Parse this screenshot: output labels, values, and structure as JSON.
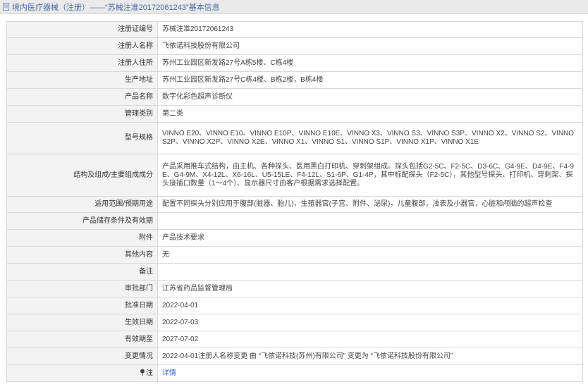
{
  "header": {
    "title": "境内医疗器械（注册）——“苏械注准20172061243”基本信息"
  },
  "rows": [
    {
      "label": "注册证编号",
      "value": "苏械注准20172061243"
    },
    {
      "label": "注册人名称",
      "value": "飞依诺科技股份有限公司"
    },
    {
      "label": "注册人住所",
      "value": "苏州工业园区新发路27号A栋5楼、C栋4楼"
    },
    {
      "label": "生产地址",
      "value": "苏州工业园区新发路27号C栋4楼、B栋2楼，B栋4楼"
    },
    {
      "label": "产品名称",
      "value": "数字化彩色超声诊断仪"
    },
    {
      "label": "管理类别",
      "value": "第二类"
    },
    {
      "label": "型号规格",
      "value": "VINNO E20、VINNO E10、VINNO E10P、VINNO E10E、VINNO X3、VINNO S3、VINNO S3P、VINNO X2、VINNO S2、VINNO S2P、VINNO X2P、VINNO X2E、VINNO X1、VINNO S1、VINNO S1P、VINNO X1P、VINNO X1E"
    },
    {
      "label": "结构及组成/主要组成成分",
      "value": "产品采用推车式结构，由主机、各种探头、医用黑白打印机、穿刺架组成。探头包括G2-5C、F2-5C、D3-6C、G4-9E、D4-9E、F4-9E、G4-9M、X4-12L、X6-16L、U5-15LE、F4-12L、S1-6P、G1-4P，其中标配探头（F2-5C），其他型号探头、打印机、穿刺架、探头接插口数量（1～4个）、显示器尺寸由客户根据需求选择配置。"
    },
    {
      "label": "适用范围/预期用途",
      "value": "配置不同探头分别应用于腹部(脏器、胎儿)，生殖器官(子宫、附件、泌尿)，儿童腹部，浅表及小器官，心脏和颅脑的超声检查"
    },
    {
      "label": "产品储存条件及有效期",
      "value": ""
    },
    {
      "label": "附件",
      "value": "产品技术要求"
    },
    {
      "label": "其他内容",
      "value": "无"
    },
    {
      "label": "备注",
      "value": ""
    },
    {
      "label": "审批部门",
      "value": "江苏省药品监督管理局"
    },
    {
      "label": "批准日期",
      "value": "2022-04-01"
    },
    {
      "label": "生效日期",
      "value": "2022-07-03"
    },
    {
      "label": "有效期至",
      "value": "2027-07-02"
    },
    {
      "label": "变更情况",
      "value": "2022-04-01注册人名称变更 由 “飞依诺科技(苏州)有限公司” 变更为 “飞依诺科技股份有限公司”"
    }
  ],
  "note_row": {
    "label": "注",
    "link": "详情"
  }
}
